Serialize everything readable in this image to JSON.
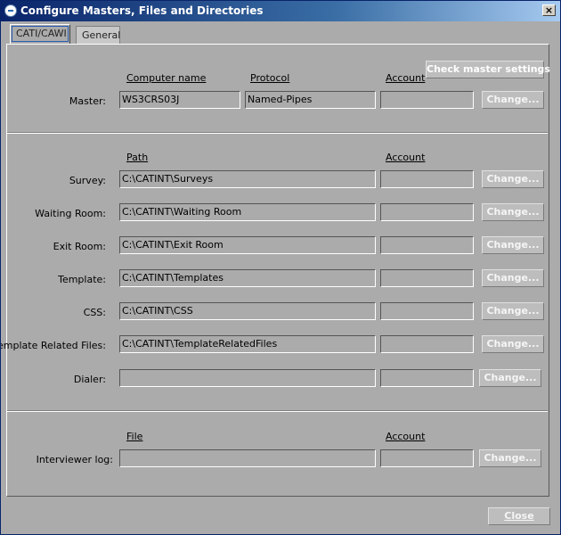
{
  "window": {
    "title": "Configure Masters, Files and Directories",
    "close_glyph": "×"
  },
  "tabs": [
    {
      "label": "CATI/CAWI"
    },
    {
      "label": "General"
    }
  ],
  "buttons": {
    "check_master": "Check master settings",
    "change": "Change...",
    "close": "Close"
  },
  "master_section": {
    "headers": {
      "computer_name": "Computer name",
      "protocol": "Protocol",
      "account": "Account"
    },
    "label": "Master:",
    "computer_name": "WS3CRS03J",
    "protocol": "Named-Pipes",
    "account": ""
  },
  "paths_section": {
    "headers": {
      "path": "Path",
      "account": "Account"
    },
    "rows": [
      {
        "label": "Survey:",
        "path": "C:\\CATINT\\Surveys",
        "account": ""
      },
      {
        "label": "Waiting Room:",
        "path": "C:\\CATINT\\Waiting Room",
        "account": ""
      },
      {
        "label": "Exit Room:",
        "path": "C:\\CATINT\\Exit Room",
        "account": ""
      },
      {
        "label": "Template:",
        "path": "C:\\CATINT\\Templates",
        "account": ""
      },
      {
        "label": "CSS:",
        "path": "C:\\CATINT\\CSS",
        "account": ""
      },
      {
        "label": "Template Related Files:",
        "path": "C:\\CATINT\\TemplateRelatedFiles",
        "account": ""
      },
      {
        "label": "Dialer:",
        "path": "",
        "account": ""
      }
    ]
  },
  "file_section": {
    "headers": {
      "file": "File",
      "account": "Account"
    },
    "label": "Interviewer log:",
    "file": "",
    "account": ""
  }
}
